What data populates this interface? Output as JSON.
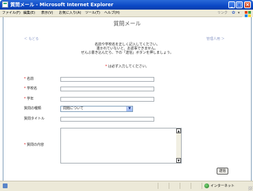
{
  "window": {
    "title": "質問メール - Microsoft Internet Explorer"
  },
  "menubar": {
    "items": [
      "ファイル(F)",
      "編集(E)",
      "表示(V)",
      "お気に入り(A)",
      "ツール(T)",
      "ヘルプ(H)"
    ],
    "links_label": "リンク"
  },
  "page": {
    "title": "質問メール",
    "back_link": "＜ もどる",
    "admin_link": "管理人用 ＞",
    "intro_lines": [
      "名前や学校名を正しく記入してください。",
      "書かれていないと、お返事できません。",
      "ぜんぶ書き込んだら、下の「送信」ボタンを押しましょう。"
    ],
    "required_mark": "*",
    "required_note": "は必ず入力してください。"
  },
  "form": {
    "name_label": "名前",
    "school_label": "学校名",
    "grade_label": "学年",
    "type_label": "質問の種類",
    "type_value": "問題について",
    "subject_label": "質問タイトル",
    "content_label": "質問の内容",
    "submit_label": "送信"
  },
  "statusbar": {
    "zone": "インターネット"
  }
}
